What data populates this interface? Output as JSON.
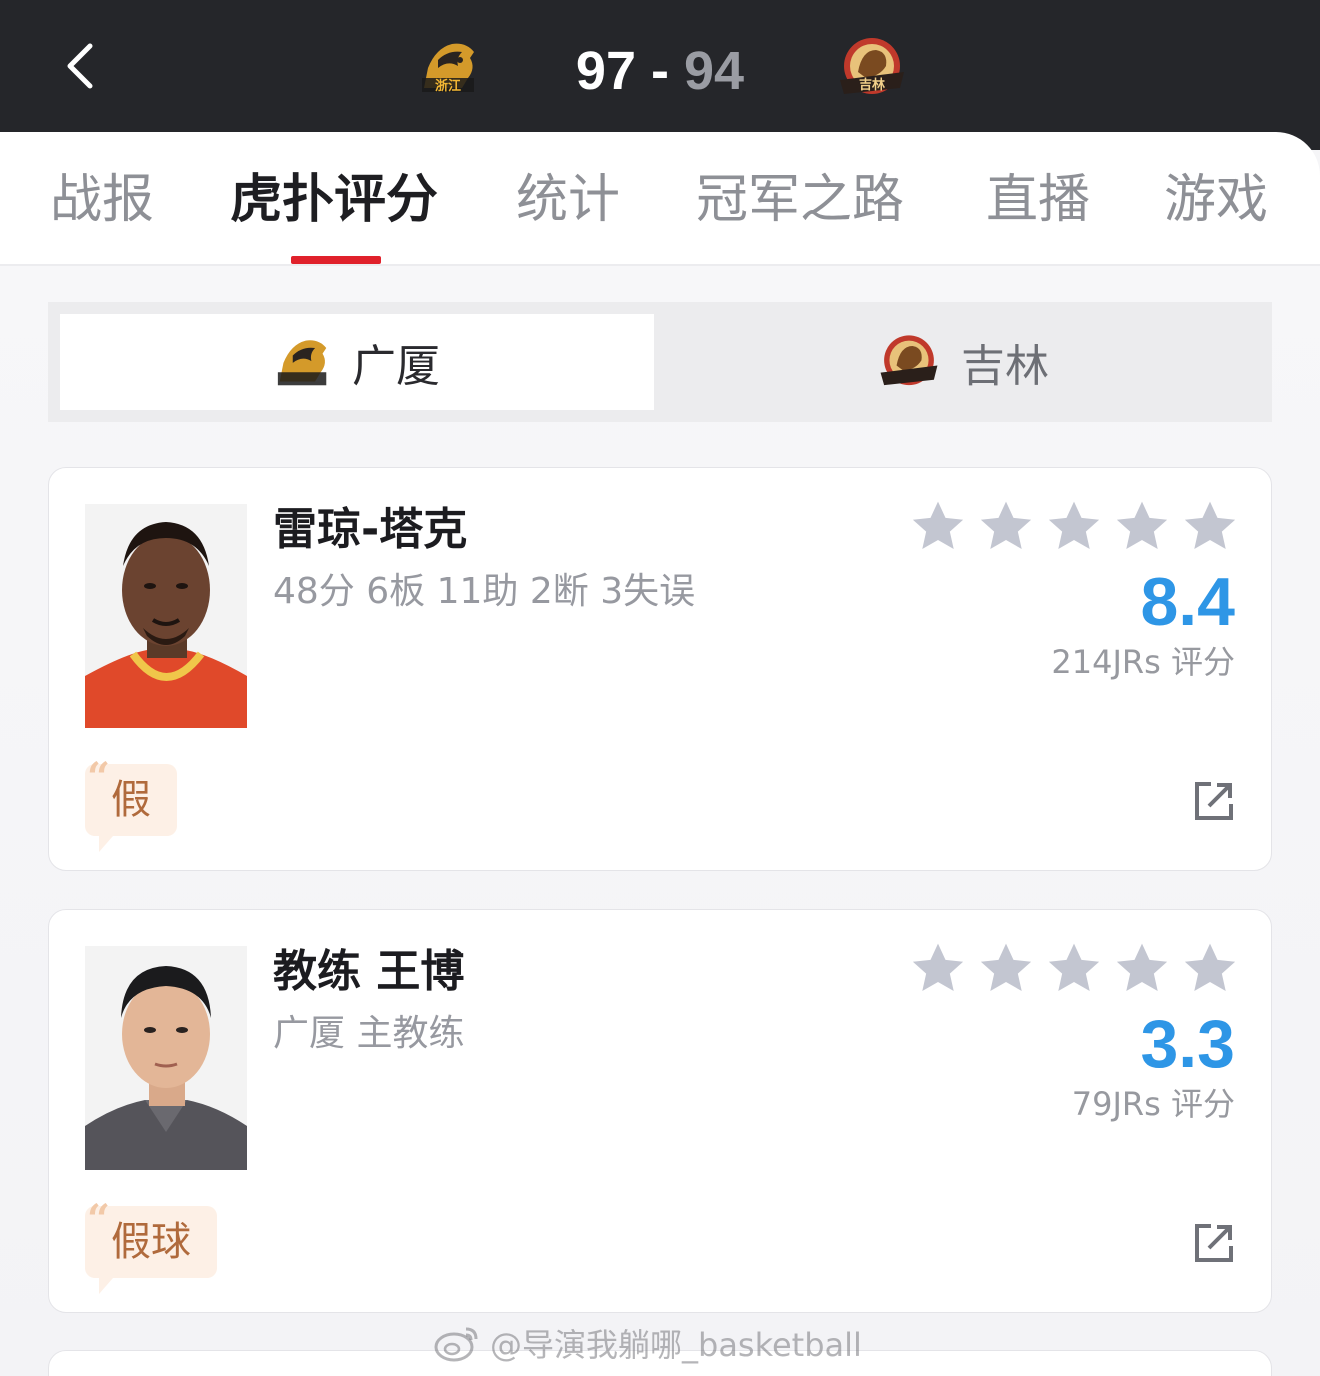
{
  "header": {
    "home_score": "97",
    "separator": " - ",
    "away_score": "94",
    "home_logo_text": "浙江",
    "away_logo_text": "吉林"
  },
  "tabs": [
    {
      "label": "战报",
      "active": false
    },
    {
      "label": "虎扑评分",
      "active": true
    },
    {
      "label": "统计",
      "active": false
    },
    {
      "label": "冠军之路",
      "active": false
    },
    {
      "label": "直播",
      "active": false
    },
    {
      "label": "游戏",
      "active": false
    }
  ],
  "team_switch": {
    "home": {
      "label": "广厦",
      "selected": true
    },
    "away": {
      "label": "吉林",
      "selected": false
    }
  },
  "cards": [
    {
      "name": "雷琼-塔克",
      "stats": "48分 6板 11助 2断 3失误",
      "stars_filled": 0,
      "rating": "8.4",
      "votes": "214JRs 评分",
      "tag": "假"
    },
    {
      "name": "教练 王博",
      "stats": "广厦 主教练",
      "stars_filled": 0,
      "rating": "3.3",
      "votes": "79JRs 评分",
      "tag": "假球"
    }
  ],
  "watermark": "@导演我躺哪_basketball",
  "colors": {
    "header_bg": "#25262a",
    "accent_red": "#e0212b",
    "rating_blue": "#2e96e6",
    "star_grey": "#c3c6d1",
    "tag_bg": "#fdf0e6"
  },
  "icons": [
    "chevron-left-icon",
    "team-logo-zhejiang",
    "team-logo-jilin",
    "star-icon",
    "share-icon",
    "quote-icon",
    "weibo-icon"
  ]
}
